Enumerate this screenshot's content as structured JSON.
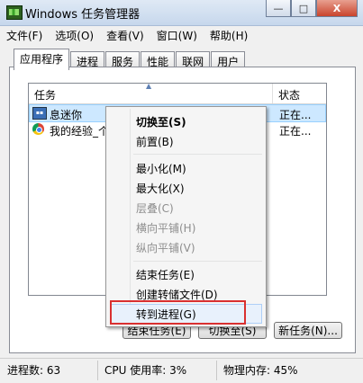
{
  "window": {
    "title": "Windows 任务管理器"
  },
  "caption_buttons": {
    "minimize": "—",
    "maximize": "□",
    "close": "X"
  },
  "menubar": [
    "文件(F)",
    "选项(O)",
    "查看(V)",
    "窗口(W)",
    "帮助(H)"
  ],
  "tabs": [
    "应用程序",
    "进程",
    "服务",
    "性能",
    "联网",
    "用户"
  ],
  "active_tab": "应用程序",
  "list": {
    "columns": {
      "task": "任务",
      "status": "状态"
    },
    "rows": [
      {
        "name": "   息迷你",
        "status": "正在...",
        "icon": "task-manager-icon"
      },
      {
        "name": "我的经验_个",
        "status": "正在...",
        "icon": "chrome-icon"
      }
    ]
  },
  "buttons": {
    "end_task": "结束任务(E)",
    "switch_to": "切换至(S)",
    "new_task": "新任务(N)..."
  },
  "status_bar": {
    "processes": "进程数: 63",
    "cpu": "CPU 使用率: 3%",
    "memory": "物理内存: 45%"
  },
  "context_menu": {
    "items": [
      {
        "label": "切换至(S)",
        "bold": true,
        "disabled": false
      },
      {
        "label": "前置(B)",
        "disabled": false
      },
      {
        "label": "最小化(M)",
        "disabled": false
      },
      {
        "label": "最大化(X)",
        "disabled": false
      },
      {
        "label": "层叠(C)",
        "disabled": true
      },
      {
        "label": "横向平铺(H)",
        "disabled": true
      },
      {
        "label": "纵向平铺(V)",
        "disabled": true
      },
      {
        "label": "结束任务(E)",
        "disabled": false
      },
      {
        "label": "创建转储文件(D)",
        "disabled": false
      },
      {
        "label": "转到进程(G)",
        "disabled": false,
        "highlighted": true
      }
    ]
  },
  "colors": {
    "annotation": "#d93030",
    "selection": "#cde8ff"
  }
}
